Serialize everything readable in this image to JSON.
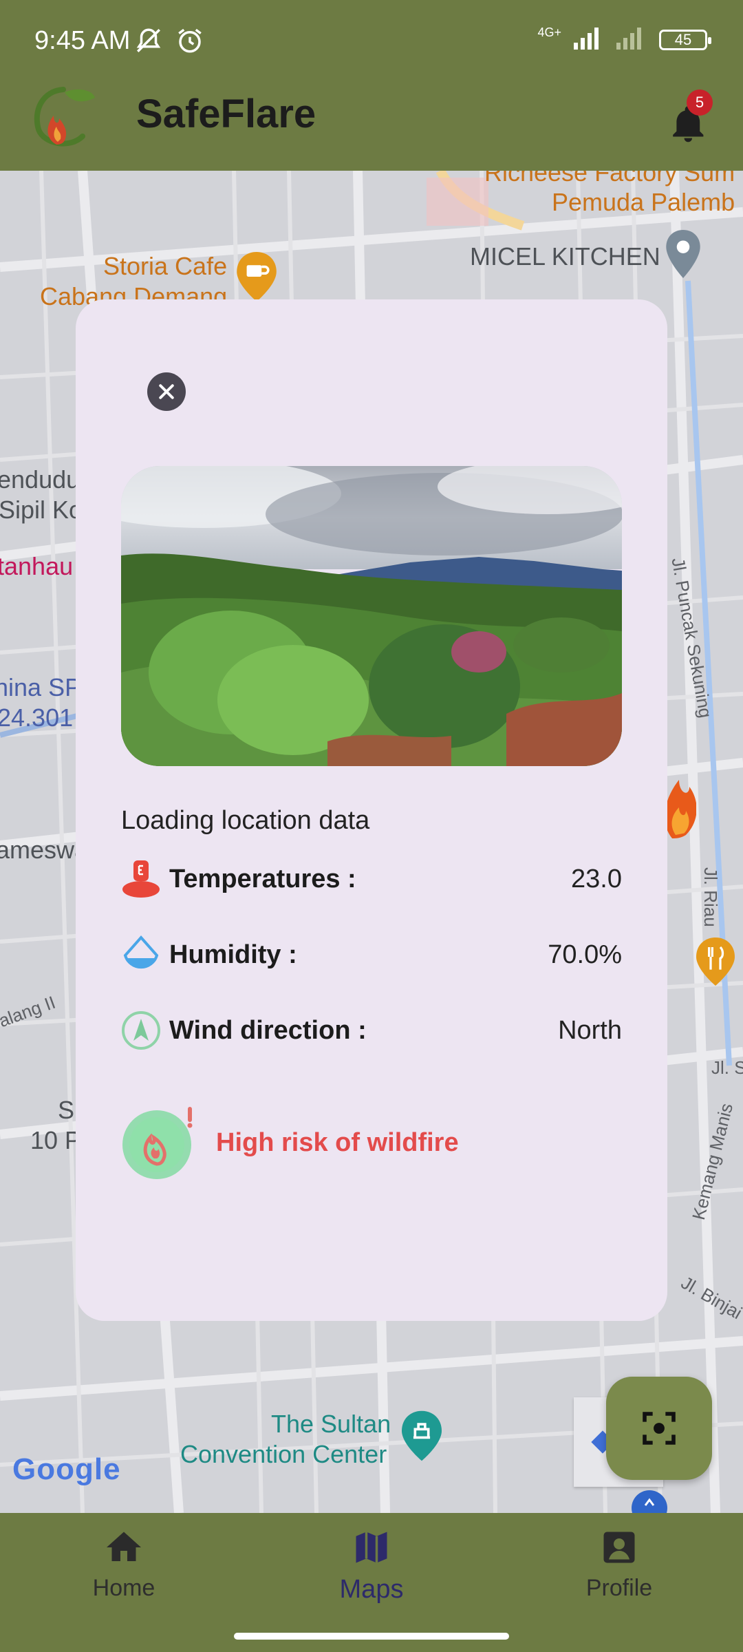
{
  "status_bar": {
    "time": "9:45 AM",
    "network": "4G+",
    "battery": "45",
    "icons": [
      "mute-icon",
      "alarm-icon",
      "signal-icon",
      "battery-icon"
    ]
  },
  "app_bar": {
    "title": "SafeFlare",
    "notification_count": "5"
  },
  "map": {
    "places": [
      {
        "name": "Richeese Factory Sum",
        "kind": "food"
      },
      {
        "name": "Pemuda Palemb",
        "kind": "food"
      },
      {
        "name": "MICEL KITCHEN",
        "kind": "place"
      },
      {
        "name": "Storia Cafe",
        "kind": "cafe"
      },
      {
        "name": "Cabang Demang",
        "kind": "cafe"
      },
      {
        "name": "endudu",
        "kind": "place"
      },
      {
        "name": "Sipil Ko",
        "kind": "place"
      },
      {
        "name": "tanhau",
        "kind": "red"
      },
      {
        "name": "hina SP",
        "kind": "blue"
      },
      {
        "name": "24.301",
        "kind": "blue"
      },
      {
        "name": "ameswa",
        "kind": "place"
      },
      {
        "name": "S",
        "kind": "place"
      },
      {
        "name": "10 P",
        "kind": "place"
      },
      {
        "name": "The Sultan",
        "kind": "venue"
      },
      {
        "name": "Convention Center",
        "kind": "venue"
      }
    ],
    "streets": [
      "Jl. Puncak Sekuning",
      "Jl. Riau",
      "Jl. S",
      "Kemang Manis",
      "Jl. Binjai",
      "alang II"
    ],
    "attribution": "Google"
  },
  "dialog": {
    "status_text": "Loading location data",
    "rows": [
      {
        "label": "Temperatures :",
        "value": "23.0",
        "icon": "thermometer-icon"
      },
      {
        "label": "Humidity :",
        "value": "70.0%",
        "icon": "humidity-icon"
      },
      {
        "label": "Wind direction :",
        "value": "North",
        "icon": "wind-direction-icon"
      }
    ],
    "risk_text": "High risk of wildfire"
  },
  "bottom_nav": {
    "items": [
      {
        "label": "Home",
        "icon": "home-icon"
      },
      {
        "label": "Maps",
        "icon": "map-icon"
      },
      {
        "label": "Profile",
        "icon": "profile-icon"
      }
    ],
    "active": "Maps"
  },
  "colors": {
    "primary": "#6d7b43",
    "dialog_bg": "#ede5f2",
    "risk_red": "#e34b4b",
    "badge": "#c8222a",
    "active_nav": "#2d2a6a"
  }
}
